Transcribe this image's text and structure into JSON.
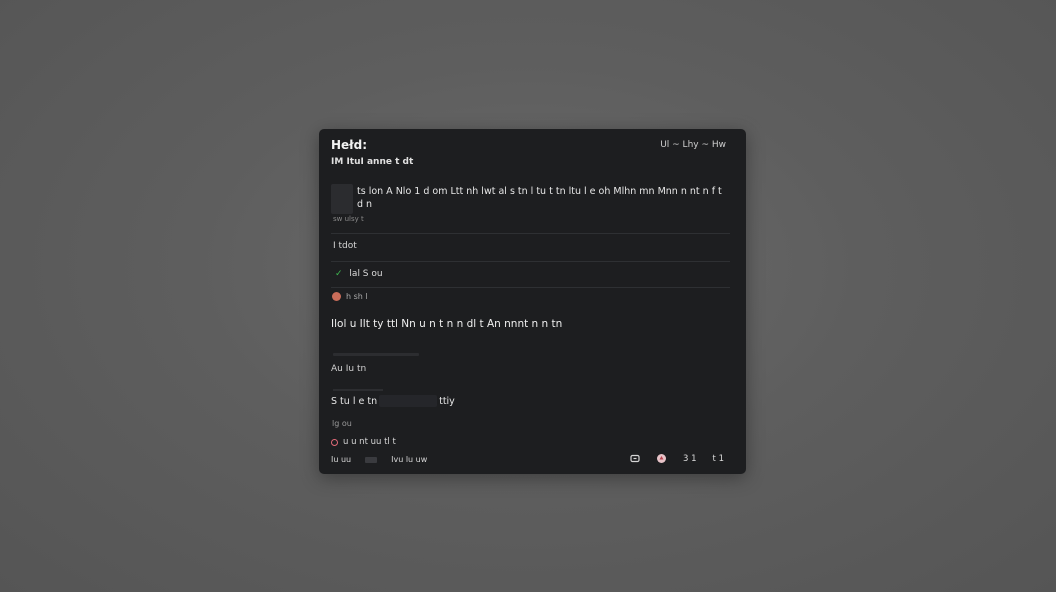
{
  "card": {
    "title": "Hełd:",
    "header_right": "Ul  ~ Lhy  ~  Hw",
    "subtitle": "IM ItuI anne t dt",
    "message": "ts lon A Nlo 1 d om Ltt nh lwt al s tn l tu t tn  ltu l e oh Mlhn mn Mnn  n nt n f   t d n",
    "meta": "sw ulsy t",
    "section_label": "I tdot ",
    "status": "lal S  ou",
    "user": "h sh l",
    "body": "Ilol u  Ilt ty ttl  Nn u   n t  n  n dl   t  An  nnnt  n  n tn",
    "sub_label": "Au Iu  tn",
    "input_prefix": "S tu l e tn",
    "input_suffix": " ttiy",
    "tag": "lg ou",
    "option": "u  u nt  uu tl t",
    "footer_left_a": "Iu uu",
    "footer_left_b": "Ivu  lu uw",
    "footer_count_a": "3 1",
    "footer_count_b": "t 1"
  },
  "colors": {
    "background": "#5e5e5e",
    "card": "#1d1e20",
    "accent_green": "#3fb950",
    "accent_red": "#e06a78"
  },
  "icons": {
    "status": "check-icon",
    "user": "avatar",
    "option": "radio-icon",
    "footer": [
      "link-icon",
      "heart-icon",
      "comment-icon",
      "share-icon"
    ]
  }
}
